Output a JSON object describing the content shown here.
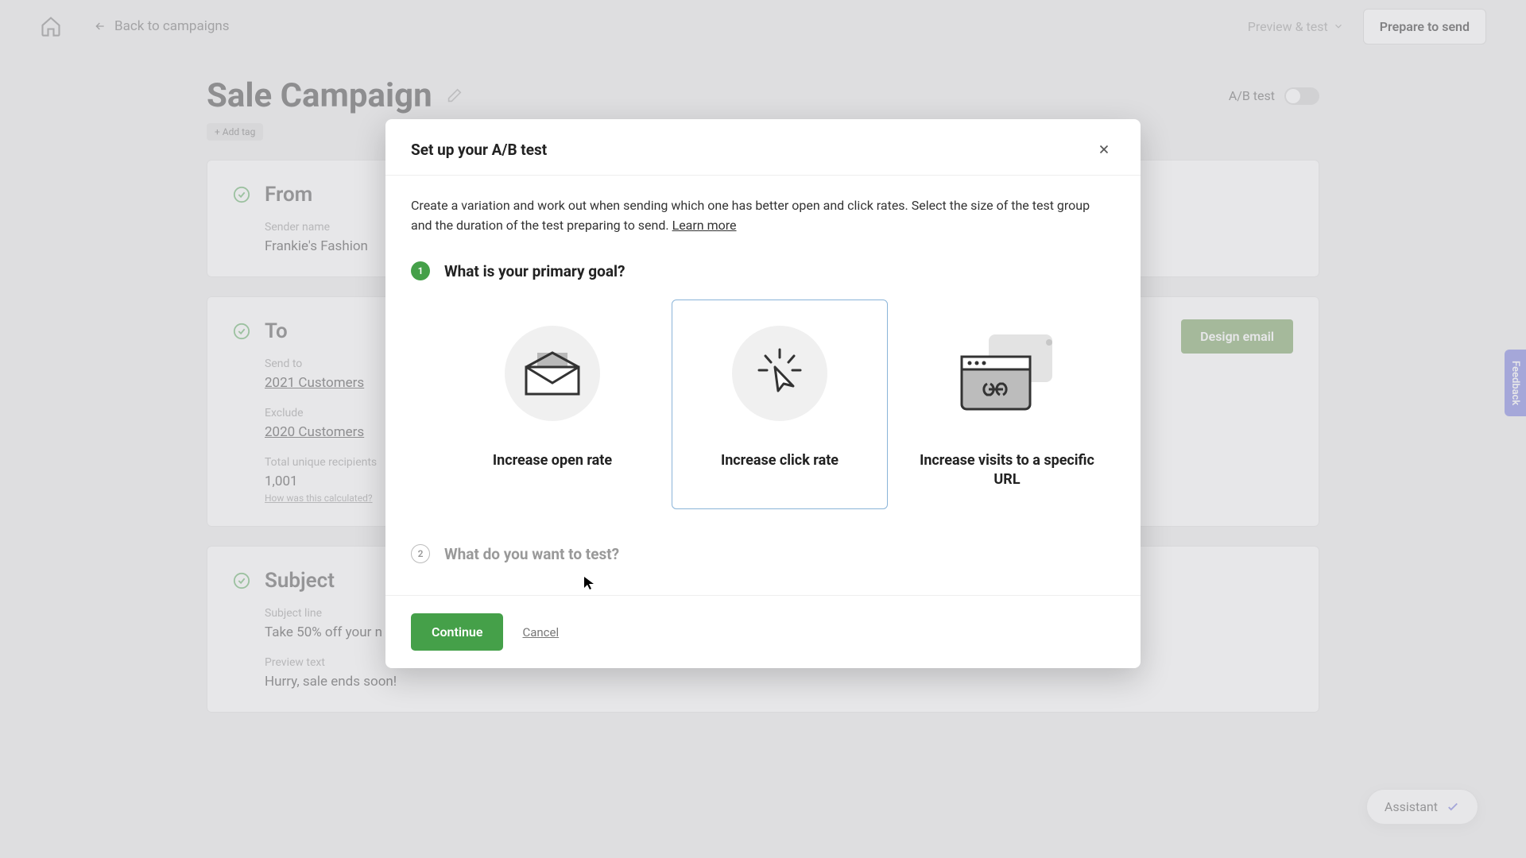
{
  "topbar": {
    "back_label": "Back to campaigns",
    "preview_label": "Preview & test",
    "prepare_label": "Prepare to send"
  },
  "page": {
    "title": "Sale Campaign",
    "add_tag_label": "+ Add tag",
    "abtest_label": "A/B test"
  },
  "from": {
    "title": "From",
    "sender_name_label": "Sender name",
    "sender_name_value": "Frankie's Fashion"
  },
  "to": {
    "title": "To",
    "send_to_label": "Send to",
    "send_to_value": "2021 Customers",
    "exclude_label": "Exclude",
    "exclude_value": "2020 Customers",
    "recipients_label": "Total unique recipients",
    "recipients_value": "1,001",
    "recipients_hint": "How was this calculated?"
  },
  "subject": {
    "title": "Subject",
    "line_label": "Subject line",
    "line_value": "Take 50% off your n",
    "preview_label": "Preview text",
    "preview_value": "Hurry, sale ends soon!"
  },
  "design": {
    "button_label": "Design email"
  },
  "modal": {
    "title": "Set up your A/B test",
    "desc": "Create a variation and work out when sending which one has better open and click rates. Select the size of the test group and the duration of the test preparing to send. ",
    "learn_more": "Learn more",
    "step1_title": "What is your primary goal?",
    "step2_title": "What do you want to test?",
    "goals": [
      {
        "label": "Increase open rate"
      },
      {
        "label": "Increase click rate"
      },
      {
        "label": "Increase visits to a specific URL"
      }
    ],
    "continue_label": "Continue",
    "cancel_label": "Cancel"
  },
  "assistant_label": "Assistant",
  "feedback_label": "Feedback"
}
